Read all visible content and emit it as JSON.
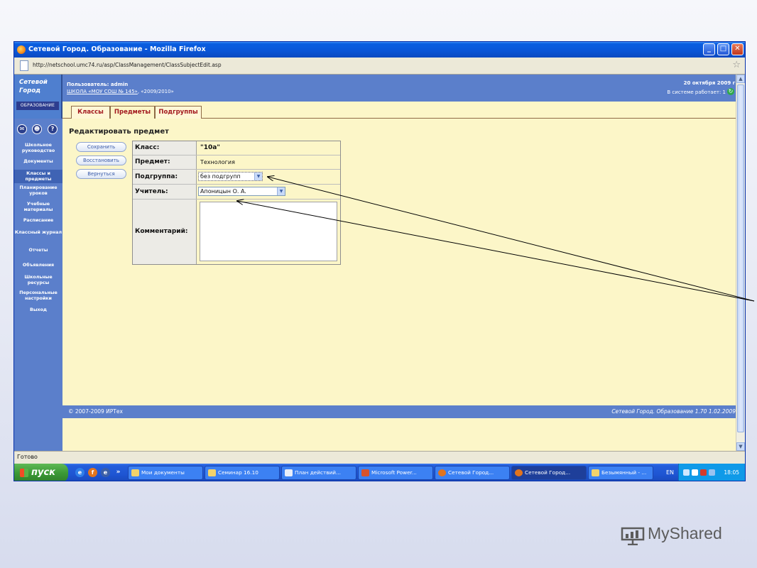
{
  "window": {
    "title": "Сетевой Город. Образование - Mozilla Firefox",
    "url": "http://netschool.umc74.ru/asp/ClassManagement/ClassSubjectEdit.asp",
    "controls": {
      "minimize": "_",
      "maximize": "□",
      "close": "✕"
    },
    "status": "Готово"
  },
  "logo": {
    "line1": "Сетевой",
    "line2": "Город",
    "line3": "ОБРАЗОВАНИЕ"
  },
  "header": {
    "user": "Пользователь: admin",
    "school_link": "ШКОЛА «МОУ СОШ № 145»",
    "school_year": ", «2009/2010»",
    "date": "20 октября 2009 г.",
    "online": "В системе работает: 1"
  },
  "tabs": [
    "Классы",
    "Предметы",
    "Подгруппы"
  ],
  "sidebar": {
    "icons": [
      "mail-icon",
      "users-icon",
      "help-icon"
    ],
    "items": [
      "Школьное руководство",
      "Документы",
      "Классы и предметы",
      "Планирование уроков",
      "Учебные материалы",
      "Расписание",
      "Классный журнал",
      "Отчеты",
      "Объявления",
      "Школьные ресурсы",
      "Персональные настройки",
      "Выход"
    ],
    "active_index": 2
  },
  "page": {
    "title": "Редактировать предмет",
    "buttons": {
      "save": "Сохранить",
      "restore": "Восстановить",
      "back": "Вернуться"
    },
    "fields": {
      "class_label": "Класс:",
      "class_value": "\"10а\"",
      "subject_label": "Предмет:",
      "subject_value": "Технология",
      "subgroup_label": "Подгруппа:",
      "subgroup_value": "без подгрупп",
      "teacher_label": "Учитель:",
      "teacher_value": "Апоницын О. А.",
      "comment_label": "Комментарий:",
      "comment_value": ""
    }
  },
  "footer": {
    "copyright": "© 2007-2009 ИРТех",
    "version": "Сетевой Город. Образование 1.70   1.02.2009"
  },
  "taskbar": {
    "start": "пуск",
    "tasks": [
      {
        "label": "Мои документы",
        "active": false
      },
      {
        "label": "Семинар 16.10",
        "active": false
      },
      {
        "label": "План действий...",
        "active": false
      },
      {
        "label": "Microsoft Power...",
        "active": false
      },
      {
        "label": "Сетевой Город...",
        "active": false
      },
      {
        "label": "Сетевой Город...",
        "active": true
      },
      {
        "label": "Безымянный - ...",
        "active": false
      }
    ],
    "language": "EN",
    "clock": "18:05"
  },
  "watermark": {
    "brand": "MyShared"
  },
  "colors": {
    "titlebar": "#0a56d8",
    "panel_blue": "#5b7fcb",
    "page_background": "#fcf6c8",
    "tab_text": "#a2181e",
    "taskbar": "#245edb",
    "start_button": "#3c9a36"
  }
}
